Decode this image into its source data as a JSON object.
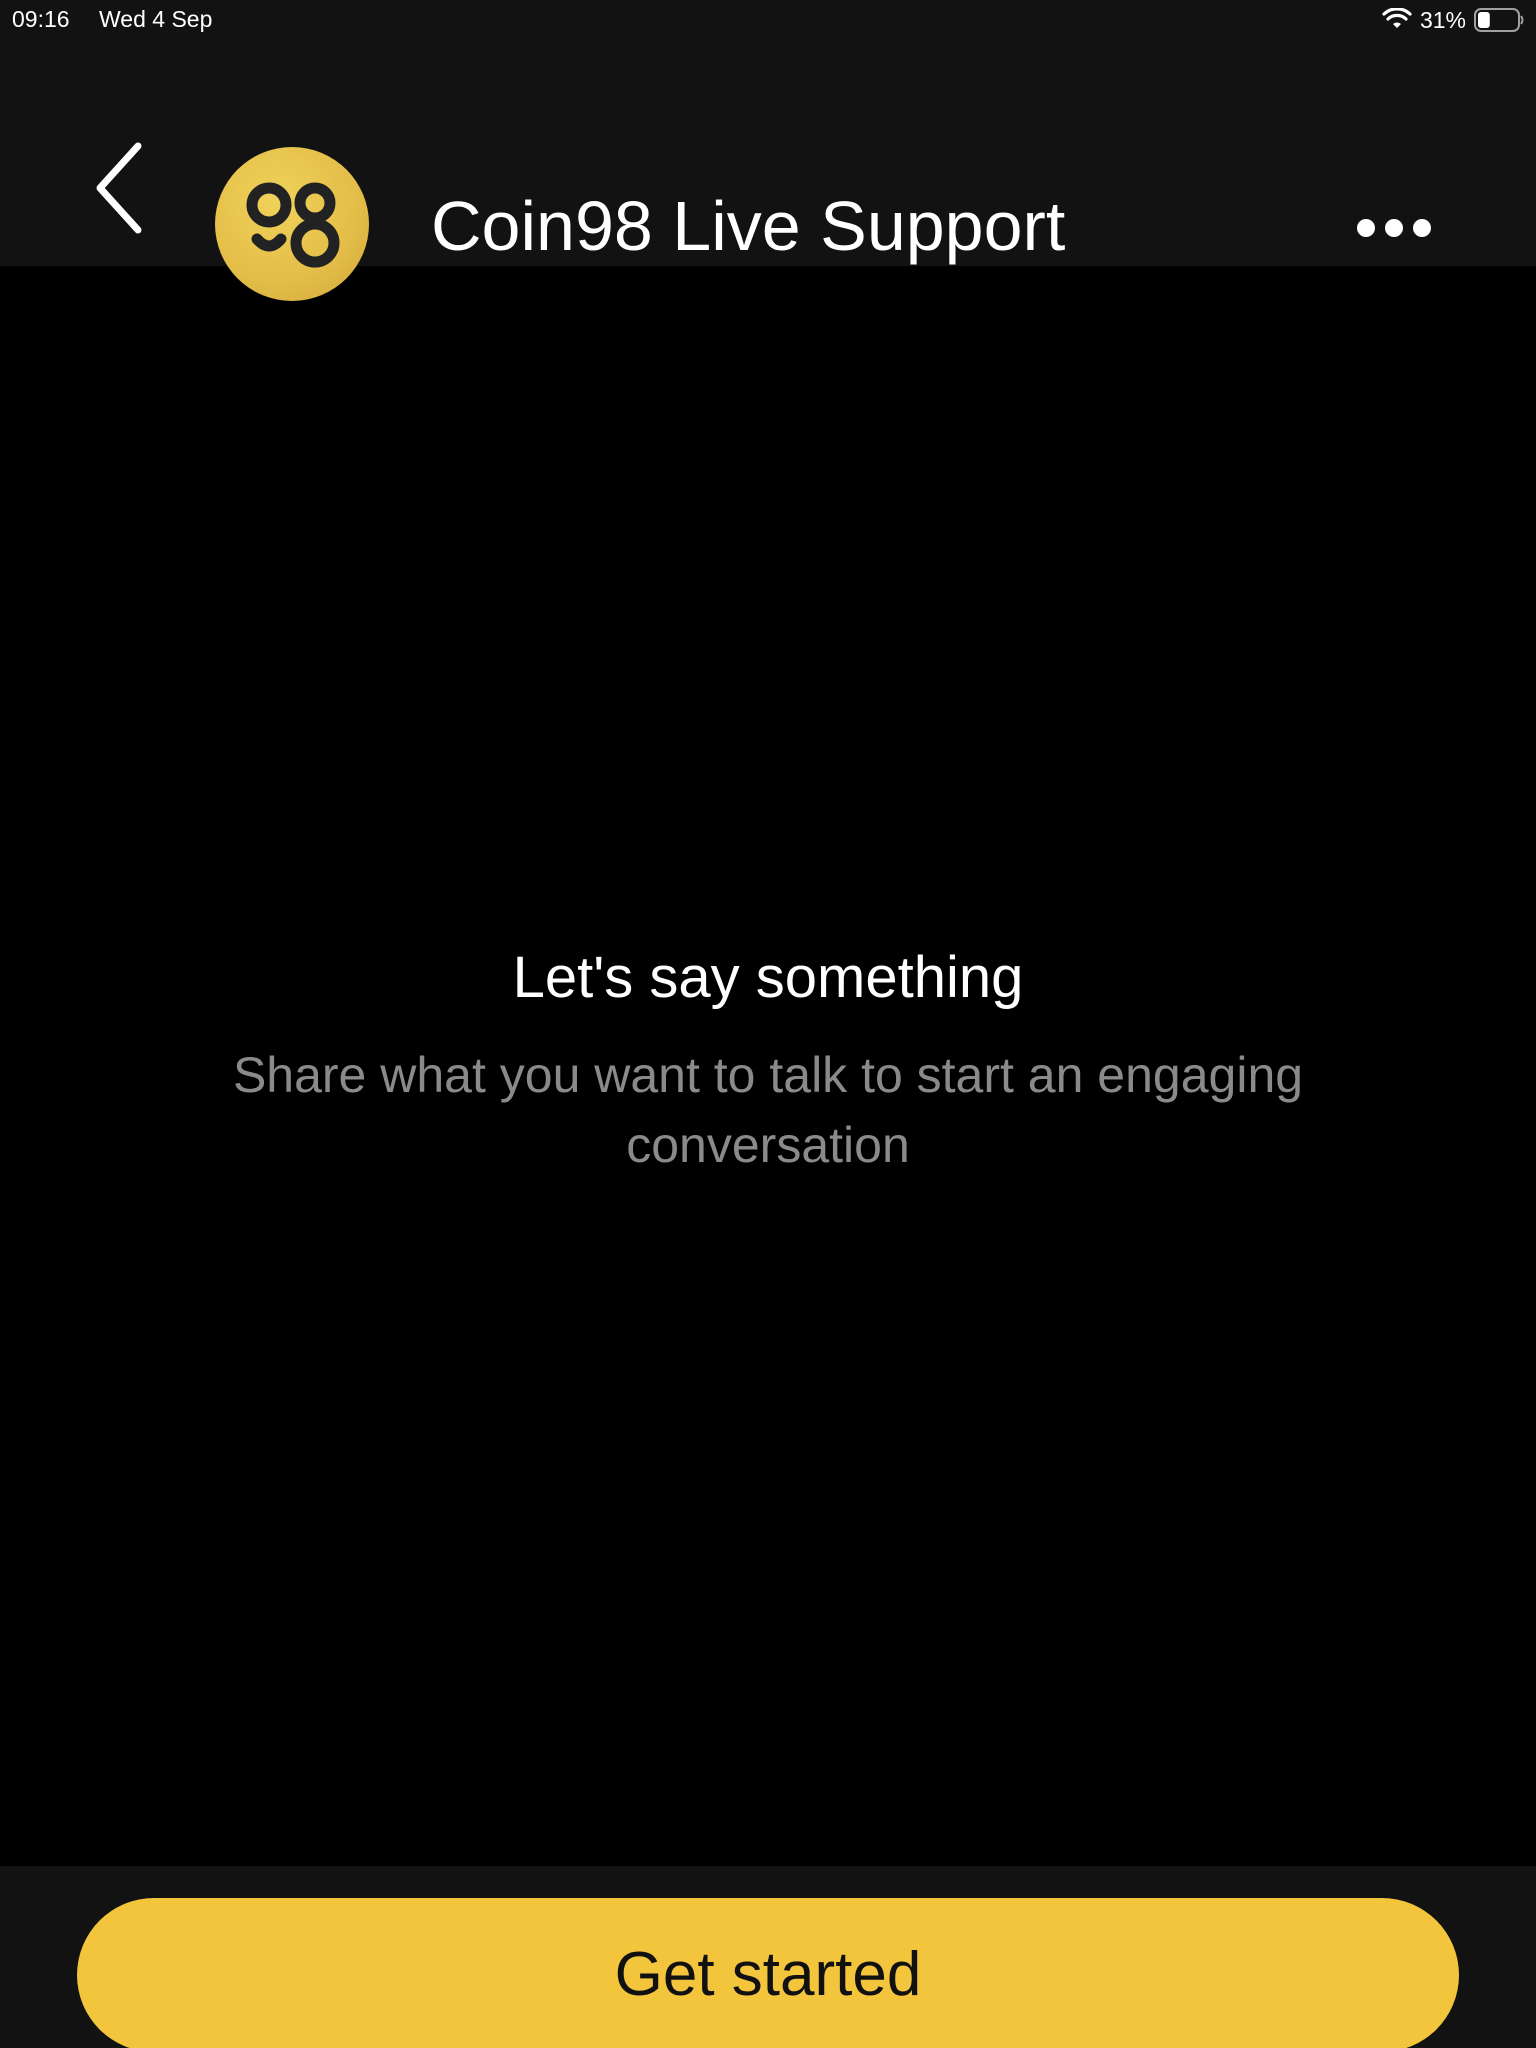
{
  "status_bar": {
    "time": "09:16",
    "date": "Wed 4 Sep",
    "battery_percent": "31%",
    "battery_level": 0.31,
    "icons": [
      "wifi-icon",
      "battery-icon"
    ]
  },
  "header": {
    "title": "Coin98 Live Support",
    "avatar_text": "98",
    "icons": [
      "chevron-left-icon",
      "more-horizontal-icon"
    ]
  },
  "empty_state": {
    "title": "Let's say something",
    "subtitle": "Share what you want to talk to start an engaging conversation"
  },
  "footer": {
    "cta_label": "Get started"
  },
  "colors": {
    "background": "#000000",
    "bars": "#121212",
    "accent": "#f2c53d",
    "muted_text": "#8a8a8a"
  }
}
